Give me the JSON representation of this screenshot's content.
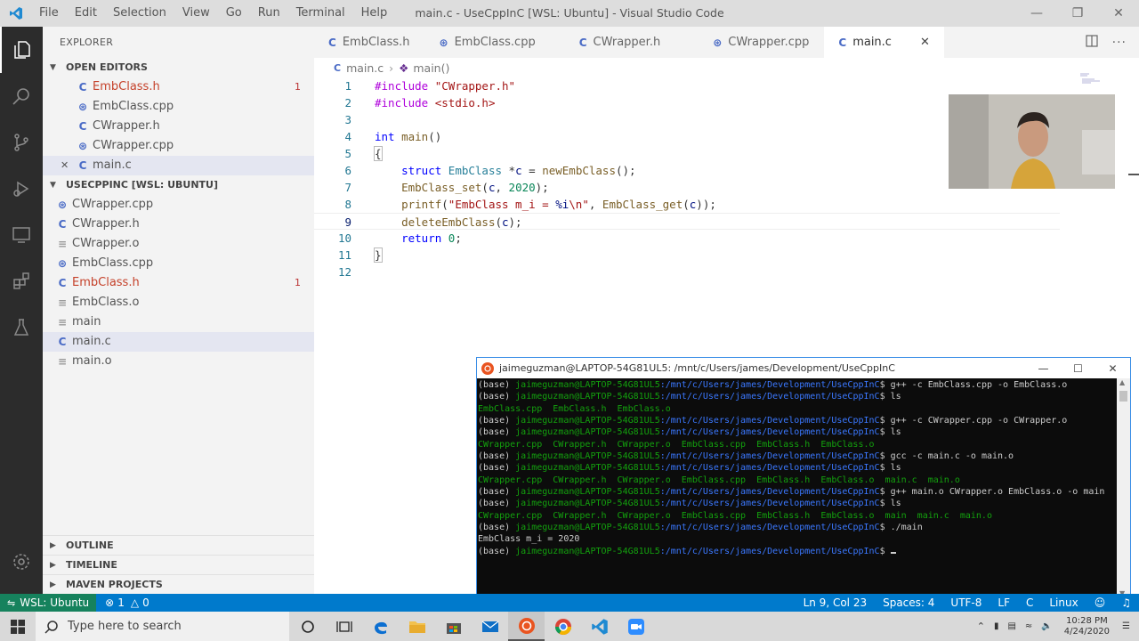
{
  "titlebar": {
    "menu": [
      "File",
      "Edit",
      "Selection",
      "View",
      "Go",
      "Run",
      "Terminal",
      "Help"
    ],
    "title": "main.c - UseCppInC [WSL: Ubuntu] - Visual Studio Code"
  },
  "sidebar": {
    "title": "EXPLORER",
    "open_editors": {
      "label": "OPEN EDITORS",
      "items": [
        {
          "name": "EmbClass.h",
          "badge": "1"
        },
        {
          "name": "EmbClass.cpp"
        },
        {
          "name": "CWrapper.h"
        },
        {
          "name": "CWrapper.cpp"
        },
        {
          "name": "main.c",
          "close": "✕"
        }
      ]
    },
    "workspace": {
      "label": "USECPPINC [WSL: UBUNTU]",
      "items": [
        {
          "name": "CWrapper.cpp"
        },
        {
          "name": "CWrapper.h"
        },
        {
          "name": "CWrapper.o"
        },
        {
          "name": "EmbClass.cpp"
        },
        {
          "name": "EmbClass.h",
          "badge": "1"
        },
        {
          "name": "EmbClass.o"
        },
        {
          "name": "main"
        },
        {
          "name": "main.c"
        },
        {
          "name": "main.o"
        }
      ]
    },
    "bottom_sections": [
      "OUTLINE",
      "TIMELINE",
      "MAVEN PROJECTS"
    ]
  },
  "editor": {
    "tabs": [
      "EmbClass.h",
      "EmbClass.cpp",
      "CWrapper.h",
      "CWrapper.cpp",
      "main.c"
    ],
    "breadcrumb": {
      "file": "main.c",
      "symbol": "main()"
    },
    "line_numbers": [
      "1",
      "2",
      "3",
      "4",
      "5",
      "6",
      "7",
      "8",
      "9",
      "10",
      "11",
      "12"
    ],
    "cursor_line": 9
  },
  "terminal": {
    "title": "jaimeguzman@LAPTOP-54G81UL5: /mnt/c/Users/james/Development/UseCppInC",
    "prompt_prefix": "(base) ",
    "user_host": "jaimeguzman@LAPTOP-54G81UL5",
    "path": ":/mnt/c/Users/james/Development/UseCppInC",
    "lines": [
      {
        "type": "cmd",
        "cmd": "$ g++ -c EmbClass.cpp -o EmbClass.o"
      },
      {
        "type": "cmd",
        "cmd": "$ ls"
      },
      {
        "type": "out",
        "text": "EmbClass.cpp  EmbClass.h  EmbClass.o"
      },
      {
        "type": "cmd",
        "cmd": "$ g++ -c CWrapper.cpp -o CWrapper.o"
      },
      {
        "type": "cmd",
        "cmd": "$ ls"
      },
      {
        "type": "out",
        "text": "CWrapper.cpp  CWrapper.h  CWrapper.o  EmbClass.cpp  EmbClass.h  EmbClass.o"
      },
      {
        "type": "cmd",
        "cmd": "$ gcc -c main.c -o main.o"
      },
      {
        "type": "cmd",
        "cmd": "$ ls"
      },
      {
        "type": "out",
        "text": "CWrapper.cpp  CWrapper.h  CWrapper.o  EmbClass.cpp  EmbClass.h  EmbClass.o  main.c  main.o"
      },
      {
        "type": "cmd",
        "cmd": "$ g++ main.o CWrapper.o EmbClass.o -o main"
      },
      {
        "type": "cmd",
        "cmd": "$ ls"
      },
      {
        "type": "out",
        "text": "CWrapper.cpp  CWrapper.h  CWrapper.o  EmbClass.cpp  EmbClass.h  EmbClass.o  main  main.c  main.o"
      },
      {
        "type": "cmd",
        "cmd": "$ ./main"
      },
      {
        "type": "plain",
        "text": "EmbClass m_i = 2020"
      },
      {
        "type": "cmd",
        "cmd": "$ "
      }
    ]
  },
  "statusbar": {
    "remote": "WSL: Ubuntu",
    "errors": "1",
    "warnings": "0",
    "position": "Ln 9, Col 23",
    "spaces": "Spaces: 4",
    "encoding": "UTF-8",
    "eol": "LF",
    "language": "C",
    "os": "Linux"
  },
  "taskbar": {
    "search_placeholder": "Type here to search",
    "time": "10:28 PM",
    "date": "4/24/2020"
  },
  "colors": {
    "accent": "#007acc",
    "remote": "#16825d",
    "terminal_green": "#13a10e",
    "terminal_blue": "#3b78ff"
  }
}
